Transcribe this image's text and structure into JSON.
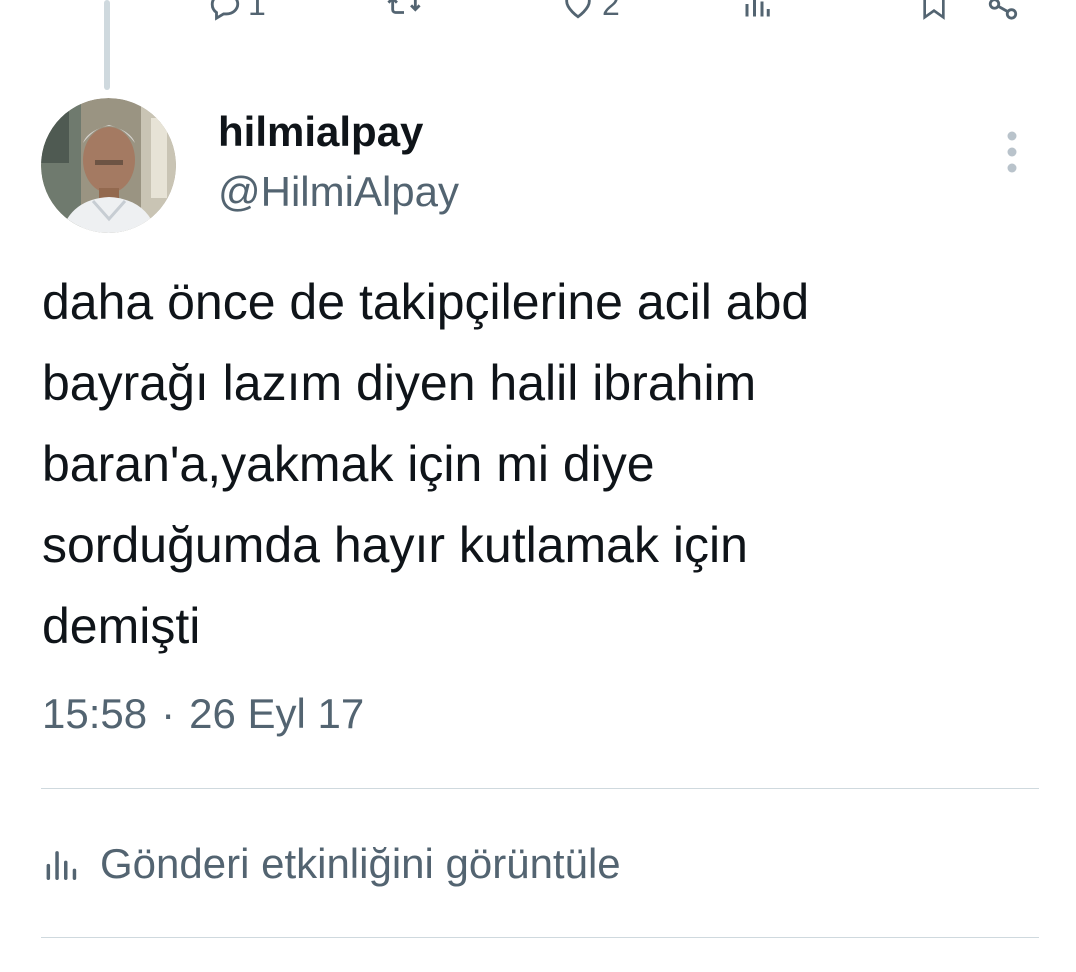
{
  "top_actions": {
    "replies": {
      "icon": "reply-icon",
      "count": "1"
    },
    "reposts": {
      "icon": "repost-icon"
    },
    "likes": {
      "icon": "heart-icon",
      "count": "2"
    },
    "views": {
      "icon": "views-icon"
    },
    "bookmark": {
      "icon": "bookmark-icon"
    },
    "share": {
      "icon": "share-icon"
    }
  },
  "author": {
    "display_name": "hilmialpay",
    "handle": "@HilmiAlpay"
  },
  "tweet": {
    "text": "daha önce de takipçilerine acil abd\nbayrağı lazım diyen halil ibrahim\nbaran'a,yakmak için mi diye\nsorduğumda hayır kutlamak için\ndemişti",
    "time": "15:58",
    "separator": "·",
    "date": "26 Eyl 17"
  },
  "activity": {
    "icon": "analytics-icon",
    "label": "Gönderi etkinliğini görüntüle"
  },
  "colors": {
    "text_primary": "#0f1419",
    "text_secondary": "#536471",
    "divider": "#cfd9de"
  }
}
